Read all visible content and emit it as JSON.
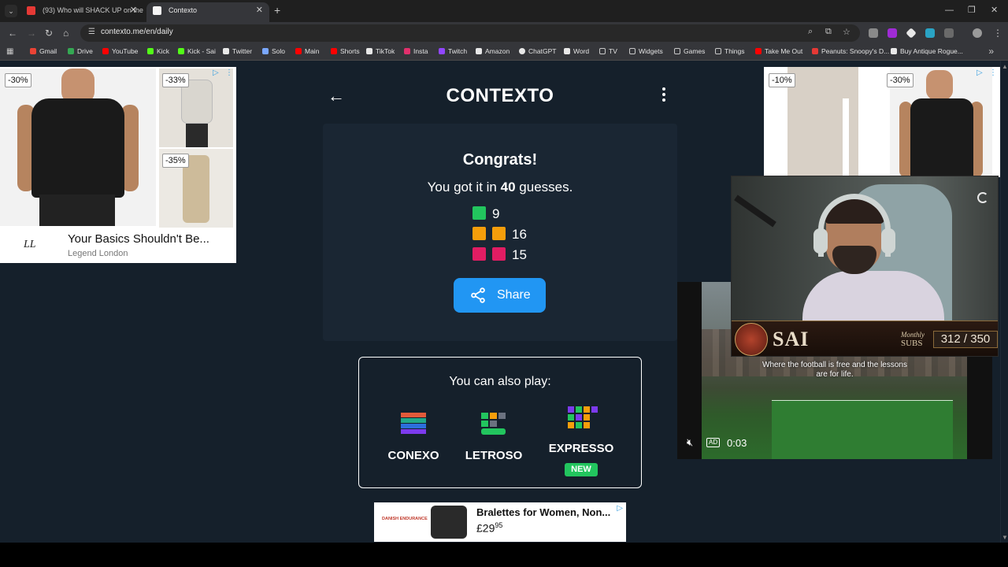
{
  "browser": {
    "tabs": [
      {
        "label": "(93) Who will SHACK UP on the",
        "active": false,
        "favicon_color": "#e53935"
      },
      {
        "label": "Contexto",
        "active": true,
        "favicon_color": "#f5f5f5"
      }
    ],
    "url": "contexto.me/en/daily",
    "bookmarks": [
      {
        "label": "Gmail",
        "color": "#ea4335"
      },
      {
        "label": "Drive",
        "color": "#34a853"
      },
      {
        "label": "YouTube",
        "color": "#ff0000"
      },
      {
        "label": "Kick",
        "color": "#53fc18"
      },
      {
        "label": "Kick - Sai",
        "color": "#53fc18"
      },
      {
        "label": "Twitter",
        "color": "#e8e8e8"
      },
      {
        "label": "Solo",
        "color": "#7aa7ff"
      },
      {
        "label": "Main",
        "color": "#ff0000"
      },
      {
        "label": "Shorts",
        "color": "#ff0000"
      },
      {
        "label": "TikTok",
        "color": "#e8e8e8"
      },
      {
        "label": "Insta",
        "color": "#e1306c"
      },
      {
        "label": "Twitch",
        "color": "#9146ff"
      },
      {
        "label": "Amazon",
        "color": "#e8e8e8"
      },
      {
        "label": "ChatGPT",
        "color": "#e8e8e8"
      },
      {
        "label": "Word",
        "color": "#e8e8e8"
      },
      {
        "label": "TV",
        "color": "#c8c8c8"
      },
      {
        "label": "Widgets",
        "color": "#c8c8c8"
      },
      {
        "label": "Games",
        "color": "#c8c8c8"
      },
      {
        "label": "Things",
        "color": "#c8c8c8"
      },
      {
        "label": "Take Me Out",
        "color": "#ff0000"
      },
      {
        "label": "Peanuts: Snoopy's D...",
        "color": "#e53935"
      },
      {
        "label": "Buy Antique Rogue...",
        "color": "#e8e8e8"
      }
    ]
  },
  "ads": {
    "left": {
      "discounts": [
        "-30%",
        "-33%",
        "-35%"
      ],
      "title": "Your Basics Shouldn't Be...",
      "brand": "Legend London",
      "logo": "LL"
    },
    "right": {
      "discounts": [
        "-10%",
        "-30%"
      ]
    },
    "bottom": {
      "title": "Bralettes for Women, Non...",
      "price_main": "£29",
      "price_cents": "95",
      "logo": "DANISH ENDURANCE"
    }
  },
  "game": {
    "title": "CONTEXTO",
    "congrats": "Congrats!",
    "result_prefix": "You got it in",
    "guess_count": "40",
    "result_suffix": "guesses.",
    "stats": [
      {
        "count": "9",
        "color": "#22c55e",
        "squares": 1
      },
      {
        "count": "16",
        "color": "#f59e0b",
        "squares": 2
      },
      {
        "count": "15",
        "color": "#e11d63",
        "squares": 2
      }
    ],
    "share_label": "Share",
    "also_play_title": "You can also play:",
    "other_games": [
      {
        "name": "CONEXO",
        "badge": ""
      },
      {
        "name": "LETROSO",
        "badge": ""
      },
      {
        "name": "EXPRESSO",
        "badge": "NEW"
      }
    ]
  },
  "video_ad": {
    "caption": "Where the football is free and the lessons are for life.",
    "ad_label": "AD",
    "time": "0:03"
  },
  "stream_overlay": {
    "name": "SAI",
    "monthly": "Monthly",
    "subs_label": "SUBS",
    "subs_count": "312 / 350"
  }
}
